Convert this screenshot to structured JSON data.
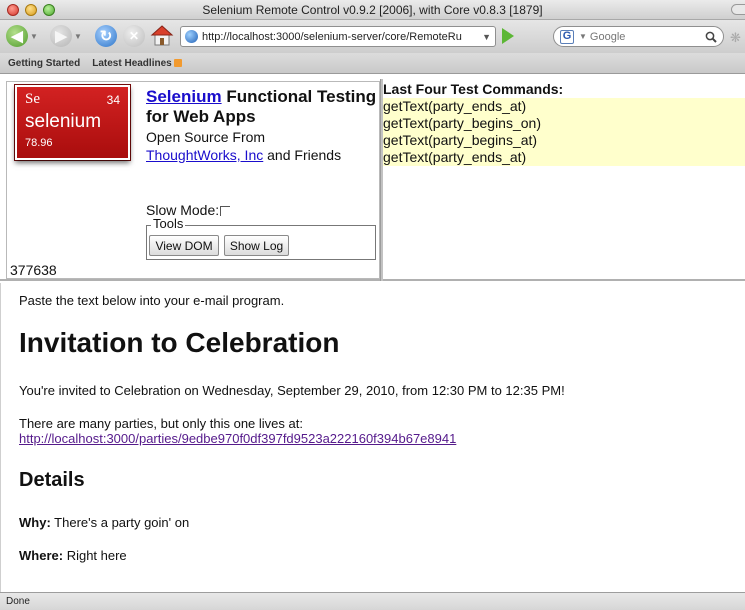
{
  "window": {
    "title": "Selenium Remote Control v0.9.2 [2006], with Core v0.8.3 [1879]"
  },
  "navbar": {
    "url": "http://localhost:3000/selenium-server/core/RemoteRu",
    "search_placeholder": "Google",
    "search_engine_letter": "G"
  },
  "bookmarks": {
    "items": [
      {
        "label": "Getting Started"
      },
      {
        "label": "Latest Headlines"
      }
    ]
  },
  "selenium_panel": {
    "logo": {
      "symbol": "Se",
      "number": "34",
      "word": "selenium",
      "mass": "78.96"
    },
    "title_link": "Selenium",
    "title_rest": "Functional Testing for Web Apps",
    "subtitle_pre": "Open Source From",
    "subtitle_link": "ThoughtWorks, Inc",
    "subtitle_post": "and Friends",
    "slow_mode_label": "Slow Mode:",
    "tools_legend": "Tools",
    "view_dom_label": "View DOM",
    "show_log_label": "Show Log",
    "counter": "377638"
  },
  "commands": {
    "heading": "Last Four Test Commands:",
    "items": [
      "getText(party_ends_at)",
      "getText(party_begins_on)",
      "getText(party_begins_at)",
      "getText(party_ends_at)"
    ]
  },
  "page": {
    "paste_note": "Paste the text below into your e-mail program.",
    "invitation_title": "Invitation to Celebration",
    "invited_text": "You're invited to Celebration on Wednesday, September 29, 2010, from 12:30 PM to 12:35 PM!",
    "parties_text": "There are many parties, but only this one lives at:",
    "party_link": "http://localhost:3000/parties/9edbe970f0df397fd9523a222160f394b67e8941",
    "details_heading": "Details",
    "why_label": "Why:",
    "why_value": "There's a party goin' on",
    "where_label": "Where:",
    "where_value": "Right here"
  },
  "status": {
    "text": "Done"
  },
  "colors": {
    "logo_red": "#c41a1a",
    "command_highlight": "#ffffcc",
    "link_blue": "#1a0dcc",
    "visited_purple": "#551a8b"
  }
}
